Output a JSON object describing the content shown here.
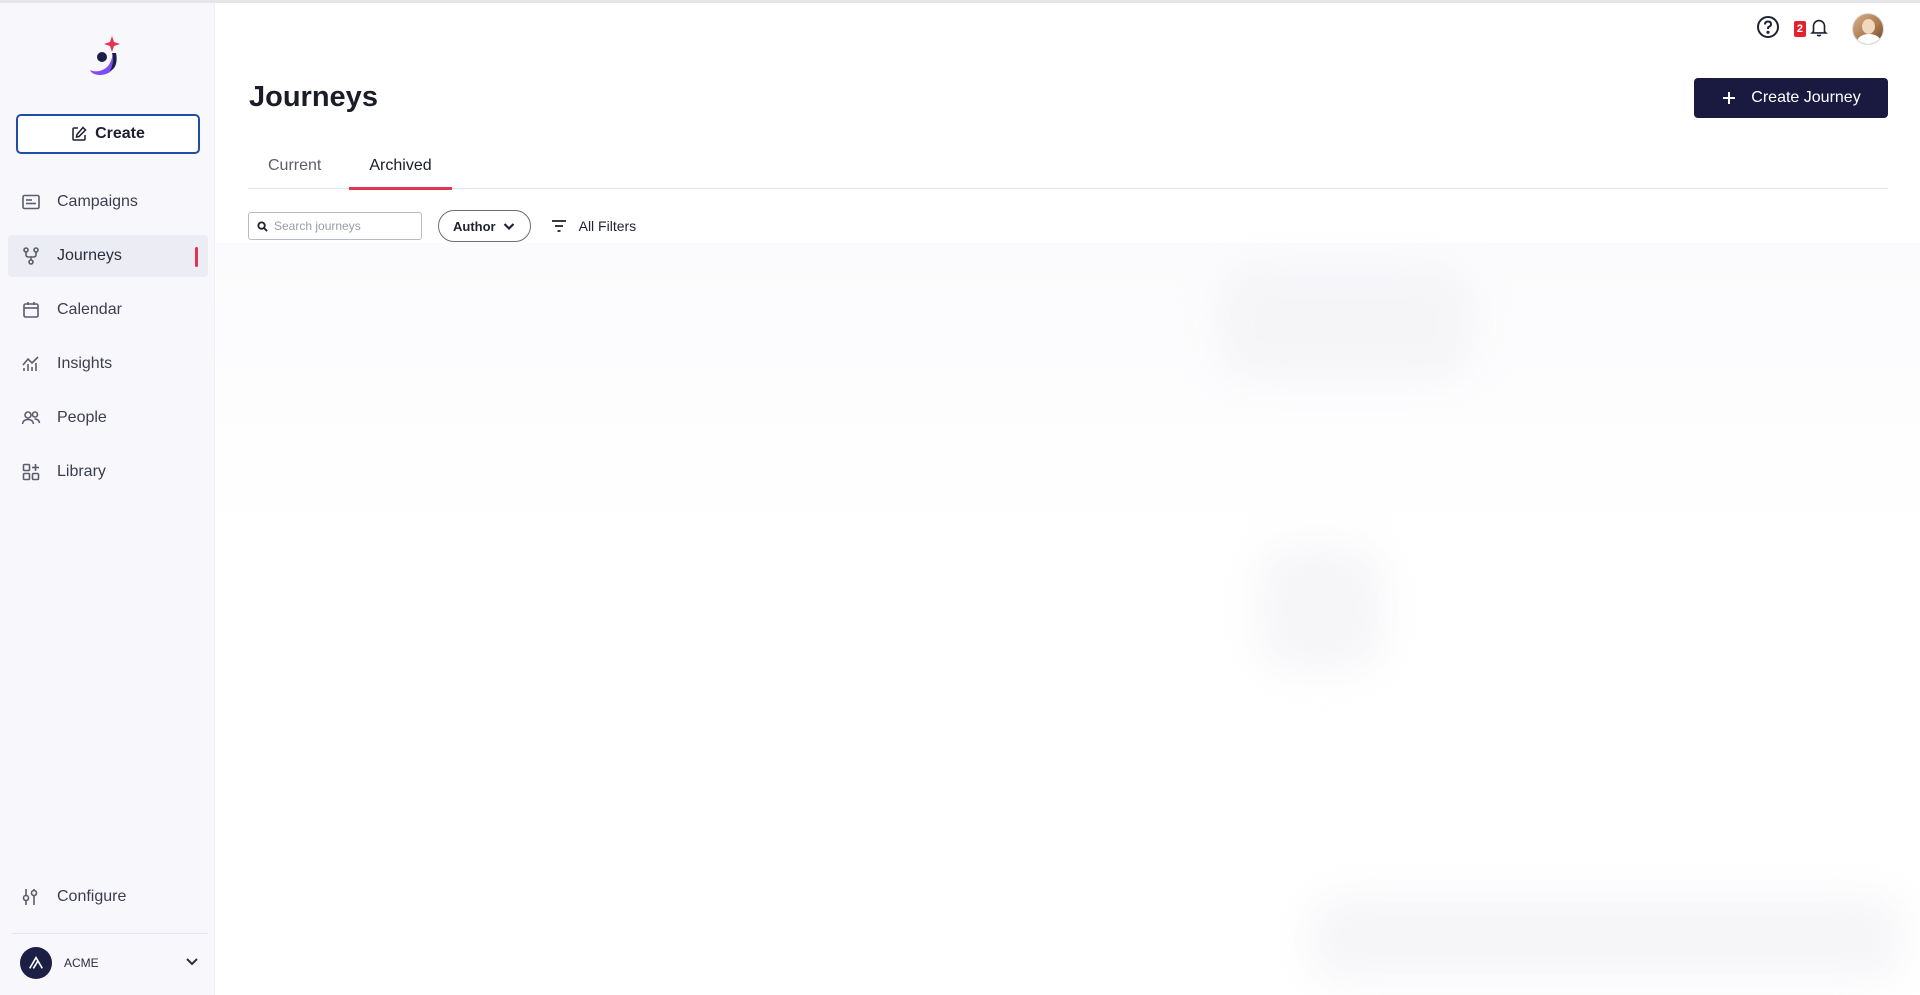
{
  "sidebar": {
    "create_label": "Create",
    "items": [
      {
        "label": "Campaigns",
        "icon": "campaigns-icon"
      },
      {
        "label": "Journeys",
        "icon": "journeys-icon",
        "active": true
      },
      {
        "label": "Calendar",
        "icon": "calendar-icon"
      },
      {
        "label": "Insights",
        "icon": "insights-icon"
      },
      {
        "label": "People",
        "icon": "people-icon"
      },
      {
        "label": "Library",
        "icon": "library-icon"
      }
    ],
    "configure_label": "Configure",
    "org_name": "ACME"
  },
  "header": {
    "title": "Journeys",
    "create_journey_label": "Create Journey",
    "notification_count": "2"
  },
  "tabs": [
    {
      "label": "Current",
      "active": false
    },
    {
      "label": "Archived",
      "active": true
    }
  ],
  "filters": {
    "search_placeholder": "Search journeys",
    "author_label": "Author",
    "all_filters_label": "All Filters"
  },
  "colors": {
    "accent": "#e1364f",
    "primary_button": "#1a1a40",
    "create_border": "#1d4ea8"
  }
}
